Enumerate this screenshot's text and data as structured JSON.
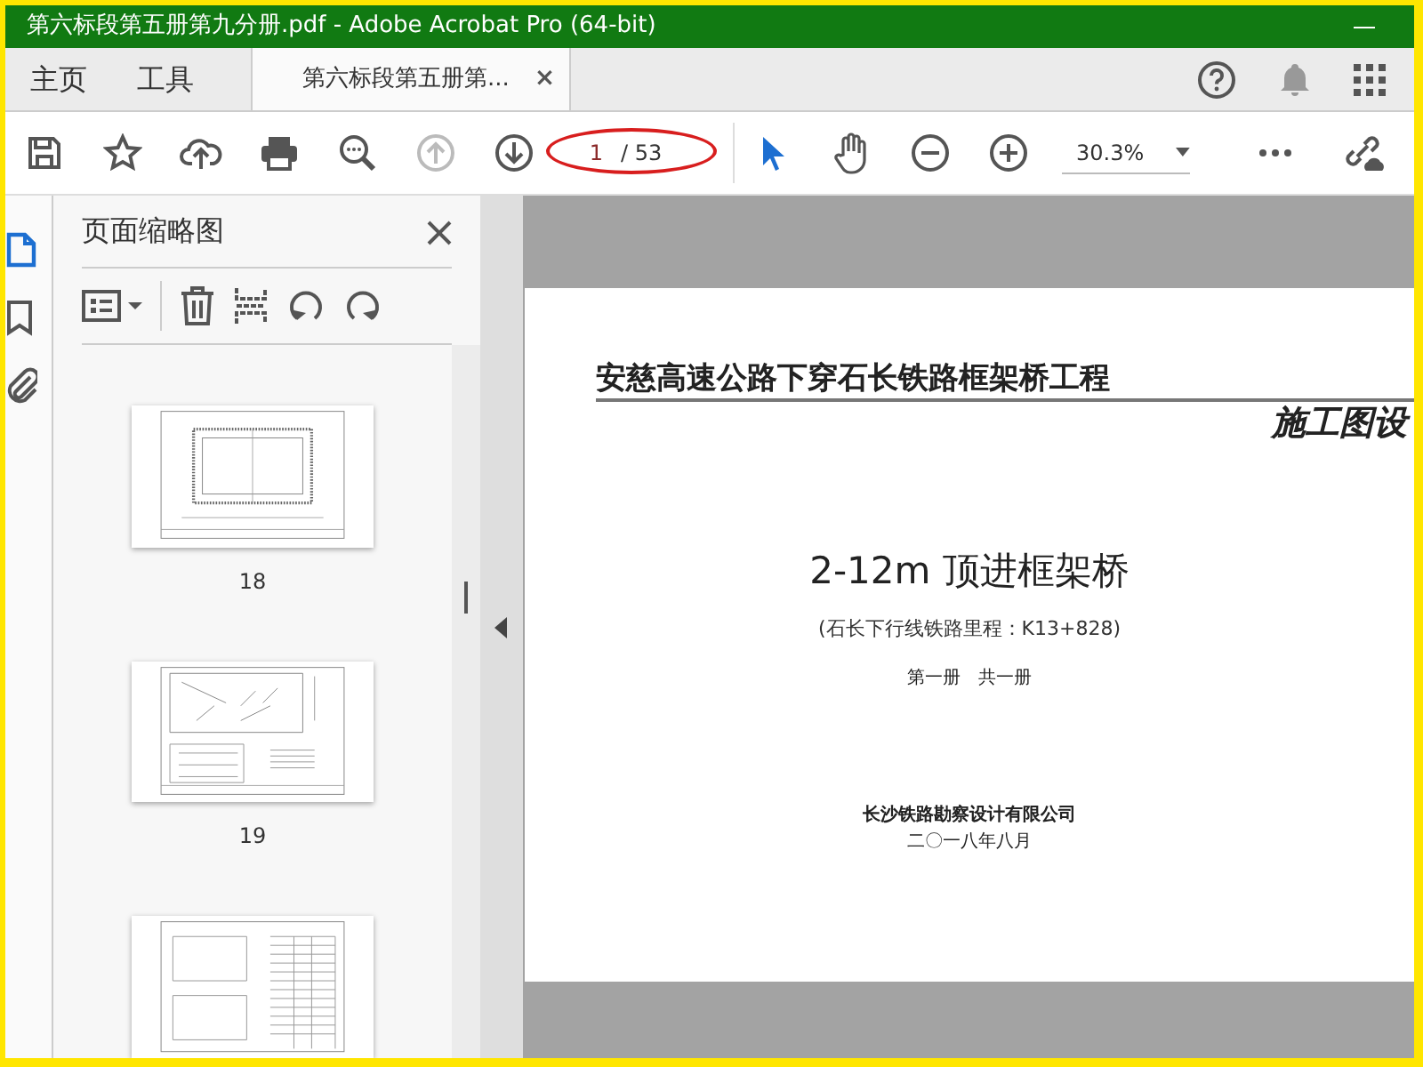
{
  "window": {
    "title": "第六标段第五册第九分册.pdf - Adobe Acrobat Pro (64-bit)"
  },
  "tabs": [
    {
      "label": "主页",
      "selected": false,
      "closable": false
    },
    {
      "label": "工具",
      "selected": false,
      "closable": false
    },
    {
      "label": "第六标段第五册第...",
      "selected": true,
      "closable": true,
      "close": "×"
    }
  ],
  "toolbar": {
    "prev_page": {
      "disabled": true
    },
    "next_page": {
      "disabled": false
    },
    "page_value": "1",
    "page_total": "/ 53",
    "zoom_value": "30.3%"
  },
  "side_nav": [
    {
      "kind": "pages",
      "selected": true
    },
    {
      "kind": "bookmarks",
      "selected": false
    },
    {
      "kind": "attachments",
      "selected": false
    }
  ],
  "thumbnail_panel": {
    "title": "页面缩略图",
    "thumbnails": [
      {
        "kind": "frame",
        "label": "18"
      },
      {
        "kind": "sketch",
        "label": "19"
      }
    ]
  },
  "document": {
    "heading": "安慈高速公路下穿石长铁路框架桥工程",
    "stage": "施工图设",
    "title": "2-12m 顶进框架桥",
    "mileage": "(石长下行线铁路里程：K13+828)",
    "volume": "第一册　共一册",
    "company": "长沙铁路勘察设计有限公司",
    "date": "二〇一八年八月"
  }
}
